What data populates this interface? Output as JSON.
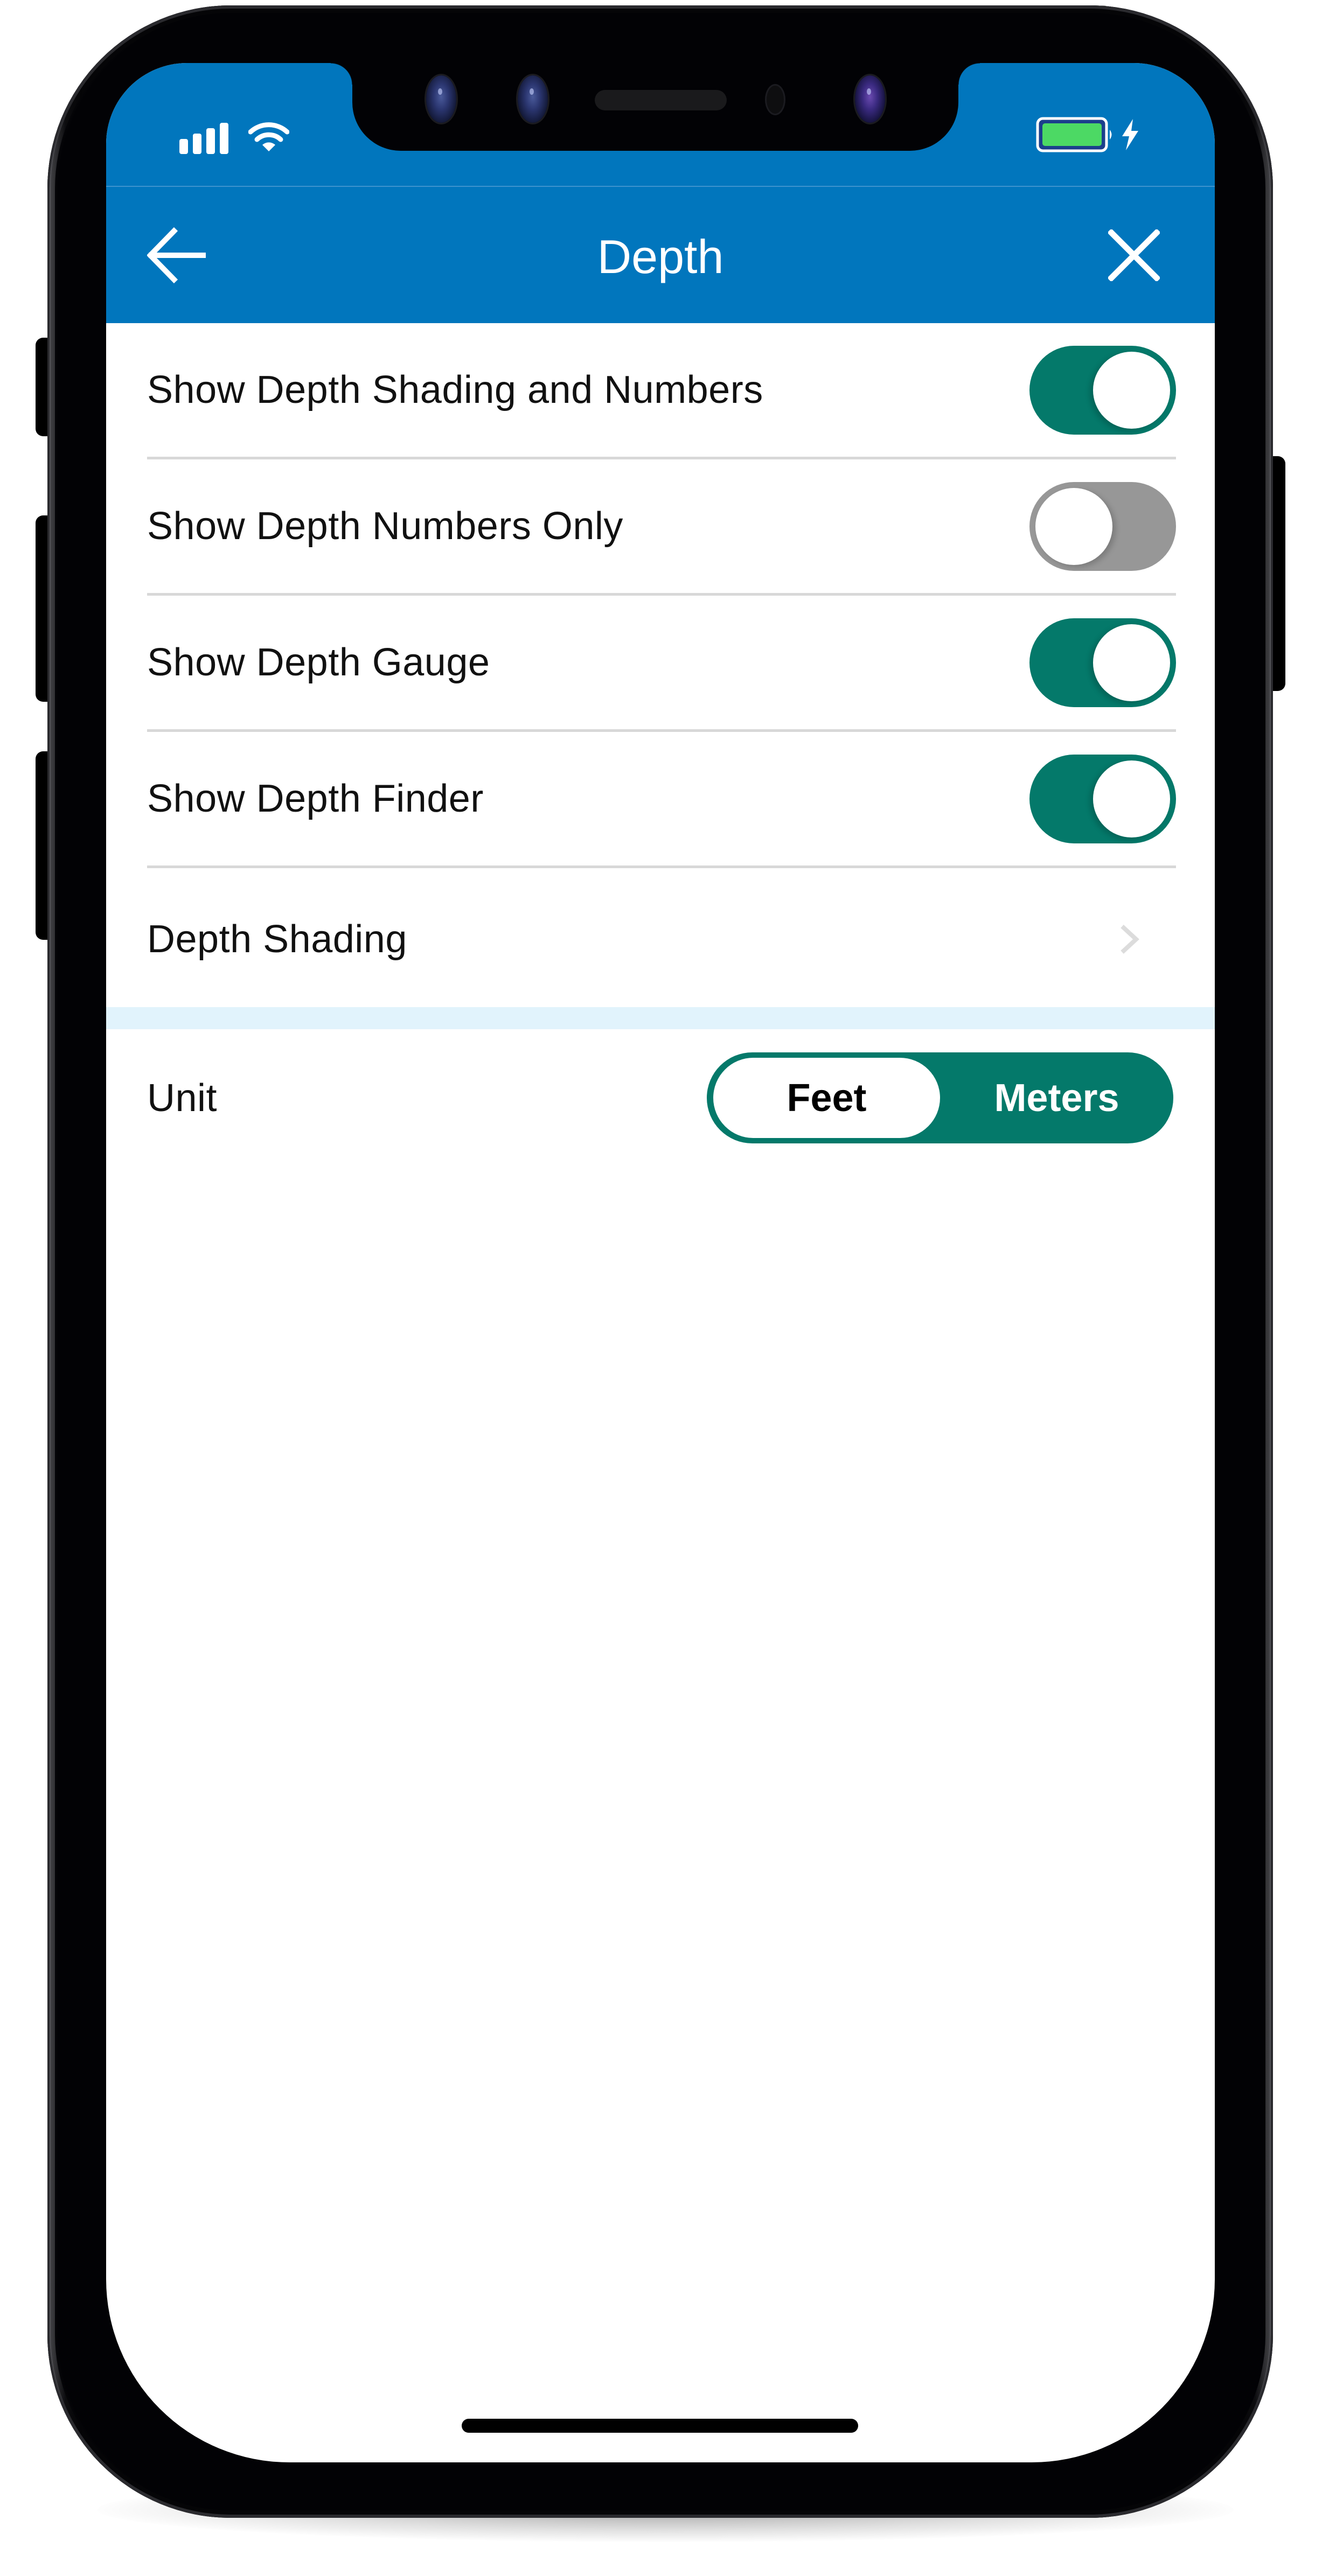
{
  "device": {
    "status_bar": {
      "signal_icon": "cellular-signal-icon",
      "signal_bars": 4,
      "wifi_icon": "wifi-icon",
      "battery_icon": "battery-icon",
      "battery_level": 1.0,
      "charging_icon": "charging-bolt-icon",
      "battery_color": "#4cd964"
    }
  },
  "header": {
    "title": "Depth",
    "back_icon": "arrow-left-icon",
    "close_icon": "close-icon",
    "background_color": "#0176bd"
  },
  "settings": {
    "toggles": [
      {
        "label": "Show Depth Shading and Numbers",
        "on": true
      },
      {
        "label": "Show Depth Numbers Only",
        "on": false
      },
      {
        "label": "Show Depth Gauge",
        "on": true
      },
      {
        "label": "Show Depth Finder",
        "on": true
      }
    ],
    "nav_item": {
      "label": "Depth Shading",
      "icon": "chevron-right-icon"
    },
    "unit": {
      "label": "Unit",
      "options": [
        "Feet",
        "Meters"
      ],
      "selected": "Feet"
    }
  },
  "colors": {
    "accent": "#04796a",
    "toggle_off": "#979797",
    "divider": "#d8d8d8",
    "section_band": "#e1f3fc"
  }
}
